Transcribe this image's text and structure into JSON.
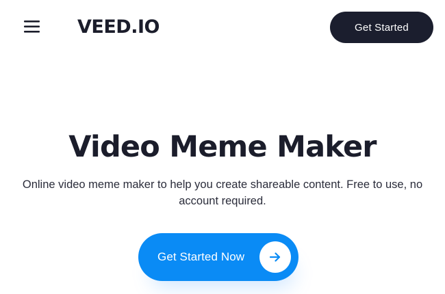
{
  "header": {
    "logo": "VEED.IO",
    "cta_label": "Get Started",
    "menu_icon": "hamburger-menu-icon"
  },
  "hero": {
    "title": "Video Meme Maker",
    "subtitle": "Online video meme maker to help you create shareable content. Free to use, no account required.",
    "cta_label": "Get Started Now",
    "cta_icon": "arrow-right-icon"
  },
  "colors": {
    "text_dark": "#1b1d2b",
    "header_button": "#1b1e2e",
    "primary_blue": "#0a8bf5",
    "background": "#ffffff"
  }
}
